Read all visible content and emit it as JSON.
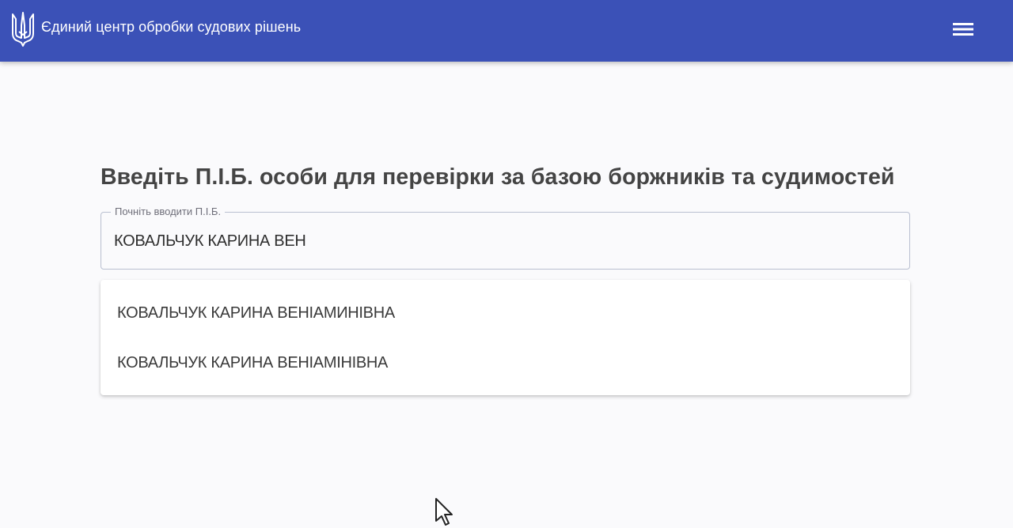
{
  "header": {
    "title": "Єдиний центр обробки судових рішень",
    "logo_icon": "trident-icon",
    "menu_icon": "hamburger-menu-icon",
    "background": "#3b51b7"
  },
  "search": {
    "heading": "Введіть П.І.Б. особи для перевірки за базою боржників та судимостей",
    "label": "Почніть вводити П.І.Б.",
    "value": "КОВАЛЬЧУК КАРИНА ВЕН"
  },
  "suggestions": [
    "КОВАЛЬЧУК КАРИНА ВЕНІАМИНІВНА",
    "КОВАЛЬЧУК КАРИНА ВЕНІАМІНІВНА"
  ]
}
